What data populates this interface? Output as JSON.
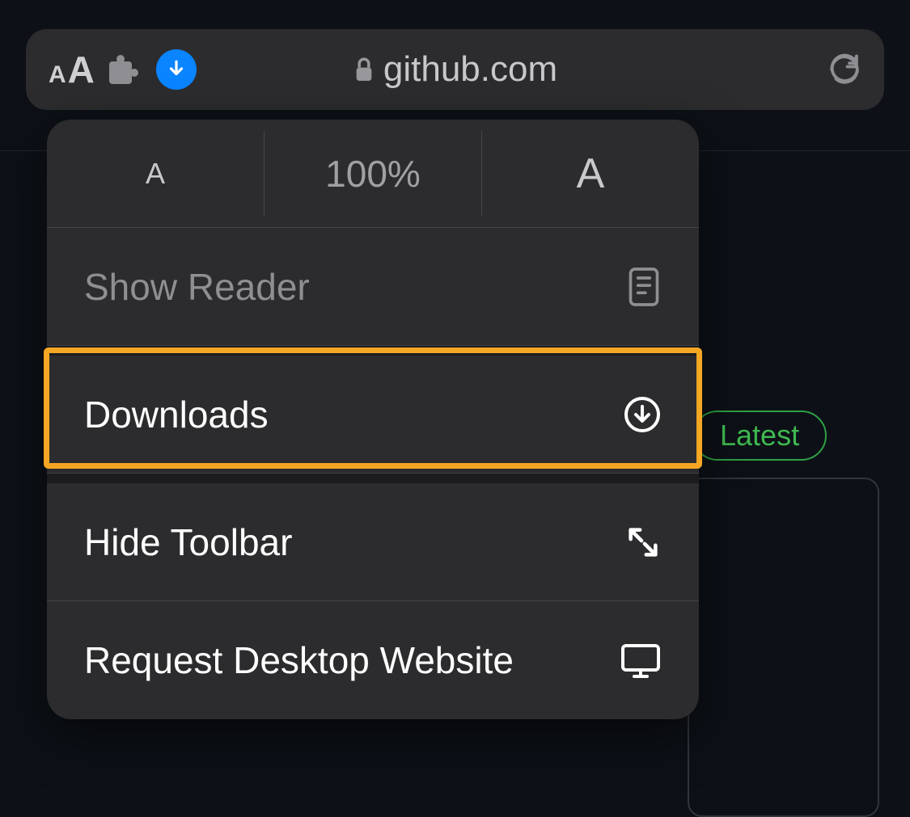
{
  "url_bar": {
    "domain": "github.com"
  },
  "menu": {
    "zoom_level": "100%",
    "show_reader": "Show Reader",
    "downloads": "Downloads",
    "hide_toolbar": "Hide Toolbar",
    "request_desktop": "Request Desktop Website"
  },
  "page": {
    "latest_badge": "Latest"
  }
}
